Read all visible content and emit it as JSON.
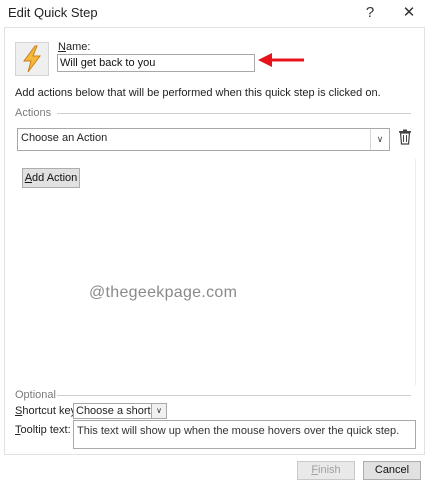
{
  "window": {
    "title": "Edit Quick Step",
    "help_label": "?",
    "close_label": "✕"
  },
  "name": {
    "label_prefix": "N",
    "label_rest": "ame:",
    "value": "Will get back to you"
  },
  "description": "Add actions below that will be performed when this quick step is clicked on.",
  "actions": {
    "section_label": "Actions",
    "selected_action": "Choose an Action",
    "add_label_prefix": "A",
    "add_label_rest": "dd Action"
  },
  "watermark": "@thegeekpage.com",
  "optional": {
    "section_label": "Optional",
    "shortcut_label_prefix": "S",
    "shortcut_label_rest": "hortcut key:",
    "shortcut_value": "Choose a shortcut",
    "tooltip_label_prefix": "T",
    "tooltip_label_rest": "ooltip text:",
    "tooltip_value": "This text will show up when the mouse hovers over the quick step."
  },
  "footer": {
    "finish_label_prefix": "F",
    "finish_label_rest": "inish",
    "cancel_label": "Cancel"
  },
  "colors": {
    "arrow": "#e8141b",
    "lightning_fill": "#f6b93b",
    "lightning_stroke": "#c8801a"
  },
  "icons": [
    "lightning-icon",
    "red-arrow-annotation",
    "trash-icon",
    "chevron-down-icon",
    "help-icon",
    "close-icon"
  ]
}
